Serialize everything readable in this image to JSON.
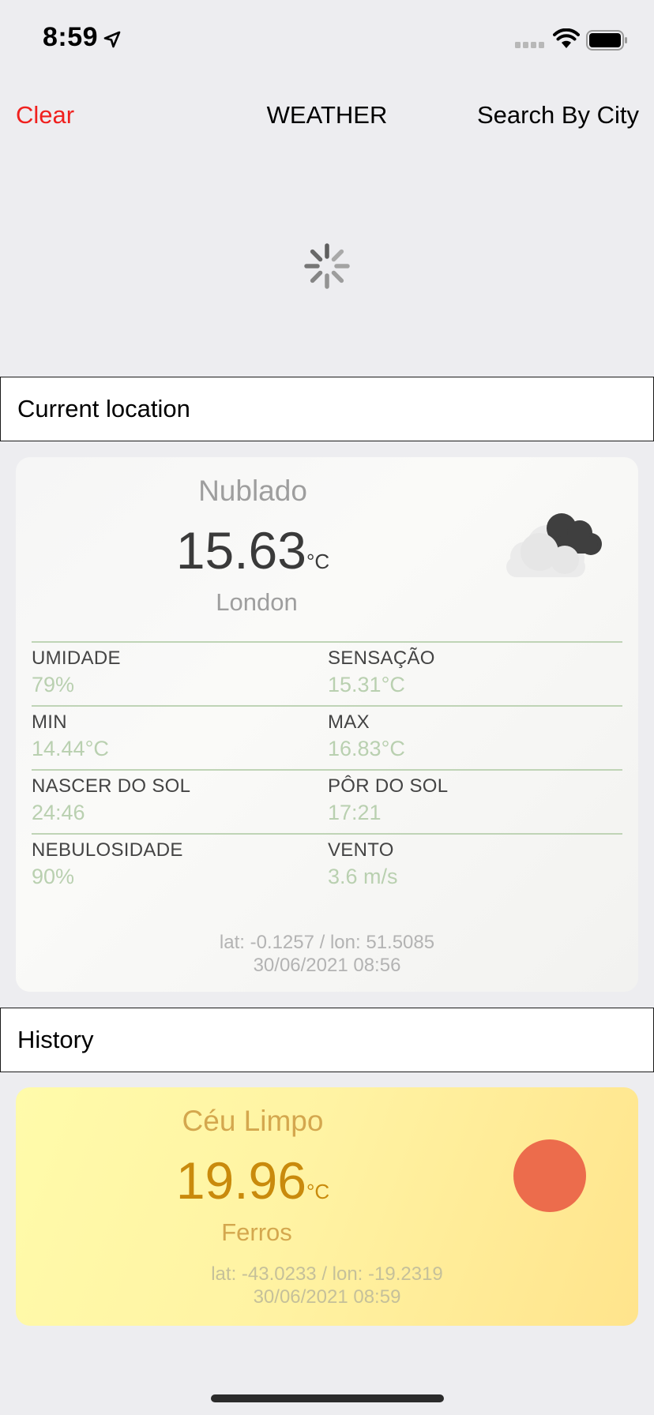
{
  "status_bar": {
    "time": "8:59"
  },
  "nav": {
    "clear_label": "Clear",
    "title": "WEATHER",
    "search_label": "Search By City"
  },
  "sections": {
    "current": "Current location",
    "history": "History"
  },
  "current": {
    "condition": "Nublado",
    "temperature": "15.63",
    "unit": "°C",
    "city": "London",
    "icon": "cloudy-night-icon",
    "details": [
      {
        "label": "UMIDADE",
        "value": "79%"
      },
      {
        "label": "SENSAÇÃO",
        "value": "15.31°C"
      },
      {
        "label": "MIN",
        "value": "14.44°C"
      },
      {
        "label": "MAX",
        "value": "16.83°C"
      },
      {
        "label": "NASCER DO SOL",
        "value": "24:46"
      },
      {
        "label": "PÔR DO SOL",
        "value": "17:21"
      },
      {
        "label": "NEBULOSIDADE",
        "value": "90%"
      },
      {
        "label": "VENTO",
        "value": "3.6 m/s"
      }
    ],
    "coords": "lat: -0.1257 / lon: 51.5085",
    "datetime": "30/06/2021 08:56"
  },
  "history": [
    {
      "condition": "Céu Limpo",
      "temperature": "19.96",
      "unit": "°C",
      "city": "Ferros",
      "icon": "sun-icon",
      "coords": "lat: -43.0233 / lon: -19.2319",
      "datetime": "30/06/2021 08:59"
    }
  ],
  "colors": {
    "clear_red": "#F0201E",
    "background": "#EDEDF0",
    "detail_value_green": "#B9D0B0",
    "history_amber": "#C98A0C",
    "sun": "#EC6C4C"
  }
}
